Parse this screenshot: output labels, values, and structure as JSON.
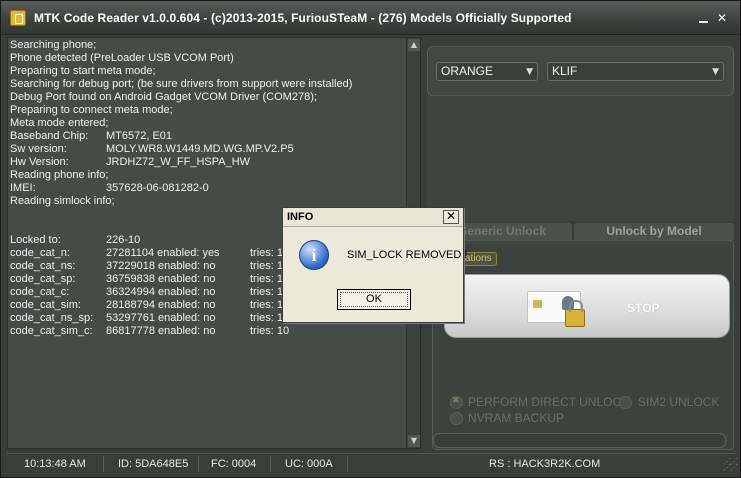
{
  "window": {
    "title": "MTK Code Reader v1.0.0.604 - (c)2013-2015, FuriouSTeaM - (276) Models Officially Supported",
    "minimize_glyph": "",
    "close_glyph": "✕"
  },
  "log": {
    "lines": [
      [
        "Searching phone;",
        "",
        ""
      ],
      [
        "Phone detected (PreLoader USB VCOM Port)",
        "",
        ""
      ],
      [
        "Preparing to start meta mode;",
        "",
        ""
      ],
      [
        "Searching for debug port; (be sure drivers from support were installed)",
        "",
        ""
      ],
      [
        "Debug Port found on Android Gadget VCOM Driver (COM278);",
        "",
        ""
      ],
      [
        "Preparing to connect meta mode;",
        "",
        ""
      ],
      [
        "Meta mode entered;",
        "",
        ""
      ],
      [
        "Baseband Chip:",
        "MT6572, E01",
        ""
      ],
      [
        "Sw version:",
        "MOLY.WR8.W1449.MD.WG.MP.V2.P5",
        ""
      ],
      [
        "Hw Version:",
        "JRDHZ72_W_FF_HSPA_HW",
        ""
      ],
      [
        "Reading phone info;",
        "",
        ""
      ],
      [
        "IMEI:",
        "357628-06-081282-0",
        ""
      ],
      [
        "Reading simlock info;",
        "",
        ""
      ],
      [
        "",
        "",
        ""
      ],
      [
        "",
        "",
        ""
      ],
      [
        "Locked to:",
        "226-10",
        ""
      ],
      [
        "code_cat_n:",
        "27281104 enabled: yes",
        "tries: 1"
      ],
      [
        "code_cat_ns:",
        "37229018 enabled: no",
        "tries: 1"
      ],
      [
        "code_cat_sp:",
        "36759838 enabled: no",
        "tries: 1"
      ],
      [
        "code_cat_c:",
        "36324994 enabled: no",
        "tries: 1"
      ],
      [
        "code_cat_sim:",
        "28188794 enabled: no",
        "tries: 1"
      ],
      [
        "code_cat_ns_sp:",
        "53297761 enabled: no",
        "tries: 1"
      ],
      [
        "code_cat_sim_c:",
        "86817778 enabled: no",
        "tries: 10"
      ]
    ],
    "scroll_up": "▲",
    "scroll_down": "▼"
  },
  "selectors": {
    "brand": "ORANGE",
    "model": "KLIF",
    "arrow": "▼"
  },
  "tabs": {
    "generic": "Generic Unlock",
    "model": "Unlock by Model"
  },
  "operations": {
    "label": "ations",
    "stop_label": "STOP",
    "options": {
      "direct": "PERFORM DIRECT UNLOCK",
      "sim2": "SIM2 UNLOCK",
      "nvram": "NVRAM BACKUP"
    }
  },
  "status": {
    "time": "10:13:48 AM",
    "id": "ID: 5DA648E5",
    "fc": "FC: 0004",
    "uc": "UC: 000A",
    "rs": "RS : HACK3R2K.COM"
  },
  "dialog": {
    "title": "INFO",
    "close_glyph": "✕",
    "icon_glyph": "i",
    "message": "SIM_LOCK REMOVED !",
    "ok_label": "OK"
  },
  "colors": {
    "accent": "#d6c36a",
    "window_bg": "#3a3e3b",
    "dialog_bg": "#ece9d8"
  }
}
